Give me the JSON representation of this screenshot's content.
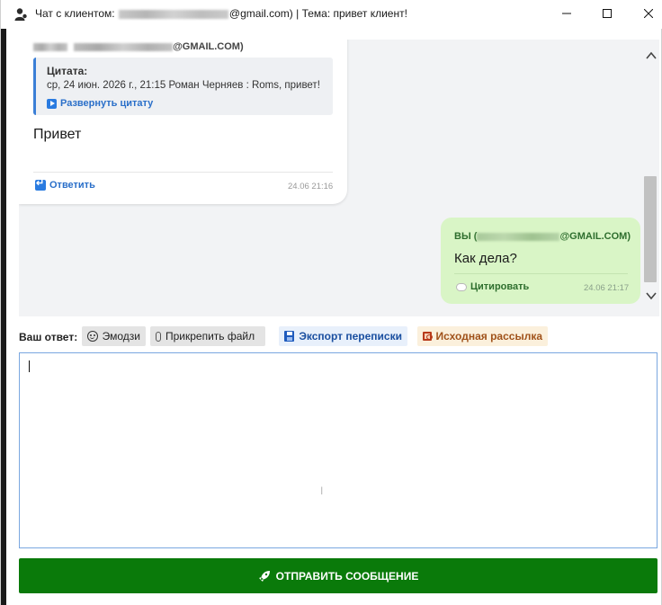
{
  "window": {
    "title_prefix": "Чат с клиентом: ",
    "title_email_suffix": "@gmail.com) | Тема: привет клиент!",
    "controls": [
      "minimize-icon",
      "maximize-icon",
      "close-icon"
    ]
  },
  "chat": {
    "incoming": {
      "sender_suffix": "@GMAIL.COM)",
      "quote_title": "Цитата:",
      "quote_text": "ср, 24 июн. 2026 г., 21:15 Роман Черняев : Roms, привет!",
      "quote_expand_label": "Развернуть цитату",
      "text": "Привет",
      "reply_label": "Ответить",
      "time": "24.06 21:16"
    },
    "outgoing": {
      "sender_prefix": "ВЫ (",
      "sender_suffix": "@GMAIL.COM)",
      "text": "Как дела?",
      "quote_label": "Цитировать",
      "time": "24.06 21:17"
    }
  },
  "toolbar": {
    "label": "Ваш ответ:",
    "emoji_label": "Эмодзи",
    "attach_label": "Прикрепить файл",
    "export_label": "Экспорт переписки",
    "origin_label": "Исходная рассылка"
  },
  "reply": {
    "value": ""
  },
  "send": {
    "label": "ОТПРАВИТЬ СООБЩЕНИЕ"
  },
  "colors": {
    "send_button": "#0a7a0a",
    "outgoing_bubble": "#d9f5c6",
    "link_blue": "#2a6fc9",
    "quote_border": "#3b7fd6"
  }
}
